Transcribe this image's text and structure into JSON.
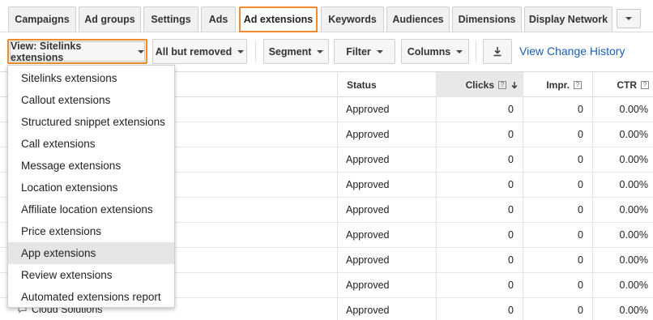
{
  "tabs": [
    "Campaigns",
    "Ad groups",
    "Settings",
    "Ads",
    "Ad extensions",
    "Keywords",
    "Audiences",
    "Dimensions",
    "Display Network"
  ],
  "active_tab": "Ad extensions",
  "toolbar": {
    "view_label": "View: Sitelinks extensions",
    "filter_status_label": "All but removed",
    "segment_label": "Segment",
    "filter_label": "Filter",
    "columns_label": "Columns",
    "change_history_link": "View Change History"
  },
  "table": {
    "columns": [
      "Status",
      "Clicks",
      "Impr.",
      "CTR"
    ],
    "sorted_column": "Clicks",
    "help_glyph": "?",
    "rows": [
      {
        "name": "",
        "status": "Approved",
        "clicks": "0",
        "impr": "0",
        "ctr": "0.00%"
      },
      {
        "name": "",
        "status": "Approved",
        "clicks": "0",
        "impr": "0",
        "ctr": "0.00%"
      },
      {
        "name": "",
        "status": "Approved",
        "clicks": "0",
        "impr": "0",
        "ctr": "0.00%"
      },
      {
        "name": "",
        "status": "Approved",
        "clicks": "0",
        "impr": "0",
        "ctr": "0.00%"
      },
      {
        "name": "",
        "status": "Approved",
        "clicks": "0",
        "impr": "0",
        "ctr": "0.00%"
      },
      {
        "name": "",
        "status": "Approved",
        "clicks": "0",
        "impr": "0",
        "ctr": "0.00%"
      },
      {
        "name": "",
        "status": "Approved",
        "clicks": "0",
        "impr": "0",
        "ctr": "0.00%"
      },
      {
        "name": "",
        "status": "Approved",
        "clicks": "0",
        "impr": "0",
        "ctr": "0.00%"
      },
      {
        "name": "Cloud Solutions",
        "status": "Approved",
        "clicks": "0",
        "impr": "0",
        "ctr": "0.00%"
      }
    ]
  },
  "view_menu": {
    "items": [
      "Sitelinks extensions",
      "Callout extensions",
      "Structured snippet extensions",
      "Call extensions",
      "Message extensions",
      "Location extensions",
      "Affiliate location extensions",
      "Price extensions",
      "App extensions",
      "Review extensions",
      "Automated extensions report"
    ],
    "hovered_item": "App extensions"
  },
  "colors": {
    "accent": "#ef8b2c",
    "link": "#1a5fb4",
    "sorted_header": "#e8e8e8"
  }
}
